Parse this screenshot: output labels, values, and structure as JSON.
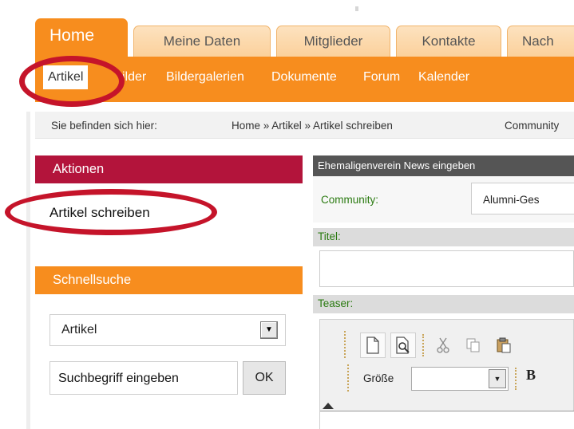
{
  "tabs": [
    {
      "label": "Home",
      "active": true
    },
    {
      "label": "Meine Daten",
      "active": false
    },
    {
      "label": "Mitglieder",
      "active": false
    },
    {
      "label": "Kontakte",
      "active": false
    },
    {
      "label": "Nach",
      "active": false
    }
  ],
  "subnav": [
    {
      "label": "Artikel",
      "active": true
    },
    {
      "label": "ilder",
      "active": false
    },
    {
      "label": "Bildergalerien",
      "active": false
    },
    {
      "label": "Dokumente",
      "active": false
    },
    {
      "label": "Forum",
      "active": false
    },
    {
      "label": "Kalender",
      "active": false
    }
  ],
  "breadcrumb": {
    "prefix": "Sie befinden sich hier:",
    "path": "Home » Artikel » Artikel schreiben",
    "extra": "Community"
  },
  "aktionen": {
    "title": "Aktionen",
    "link": "Artikel schreiben"
  },
  "schnellsuche": {
    "title": "Schnellsuche",
    "selected": "Artikel",
    "input_value": "Suchbegriff eingeben",
    "ok_label": "OK"
  },
  "form": {
    "header": "Ehemaligenverein News eingeben",
    "community_label": "Community:",
    "community_value": "Alumni-Ges",
    "titel_label": "Titel:",
    "teaser_label": "Teaser:",
    "size_label": "Größe",
    "bold_label": "B"
  },
  "colors": {
    "accent_orange": "#f78d1e",
    "aktionen_red": "#b3143b",
    "annotation_red": "#c5142a",
    "form_label_green": "#2a7a10"
  }
}
